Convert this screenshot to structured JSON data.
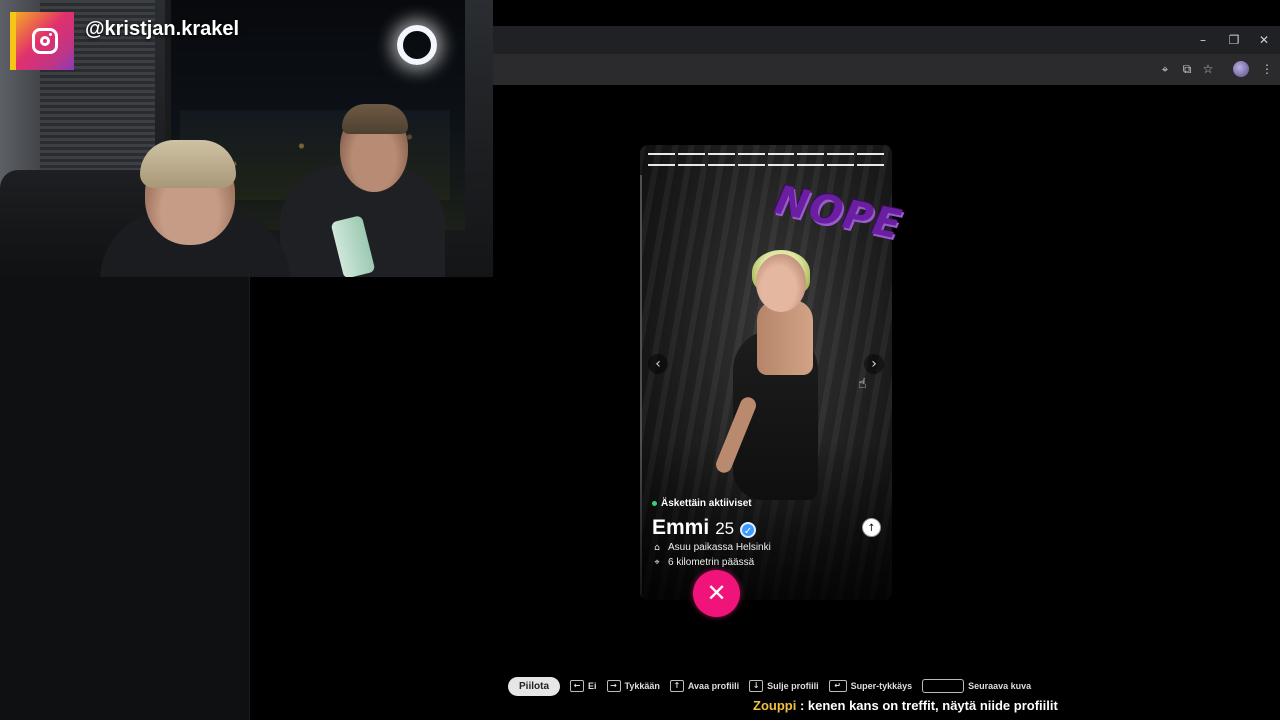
{
  "overlay": {
    "instagram_handle": "@kristjan.krakel"
  },
  "browser": {
    "window_controls": [
      "–",
      "❐",
      "✕"
    ],
    "toolbar_icons": [
      "location-icon",
      "install-app-icon",
      "star-icon",
      "profile-avatar",
      "menu-icon"
    ]
  },
  "profile": {
    "stamp": "NOPE",
    "activity": "Äskettäin aktiiviset",
    "name": "Emmi",
    "age": "25",
    "verified": true,
    "lives_in": "Asuu paikassa Helsinki",
    "distance": "6 kilometrin päässä",
    "photo_count": 8
  },
  "shortcuts": {
    "hide": "Piilota",
    "nope": "Ei",
    "like": "Tykkään",
    "open_profile": "Avaa profiili",
    "close_profile": "Sulje profiili",
    "super_like": "Super-tykkäys",
    "next_photo": "Seuraava kuva"
  },
  "chat": {
    "user": "Zouppi",
    "separator": " : ",
    "message": "kenen kans on treffit, näytä niide profiilit"
  },
  "colors": {
    "nope_button": "#f0147a",
    "verified": "#3d9bff",
    "online_dot": "#36d07a",
    "chat_user": "#f0c040"
  }
}
